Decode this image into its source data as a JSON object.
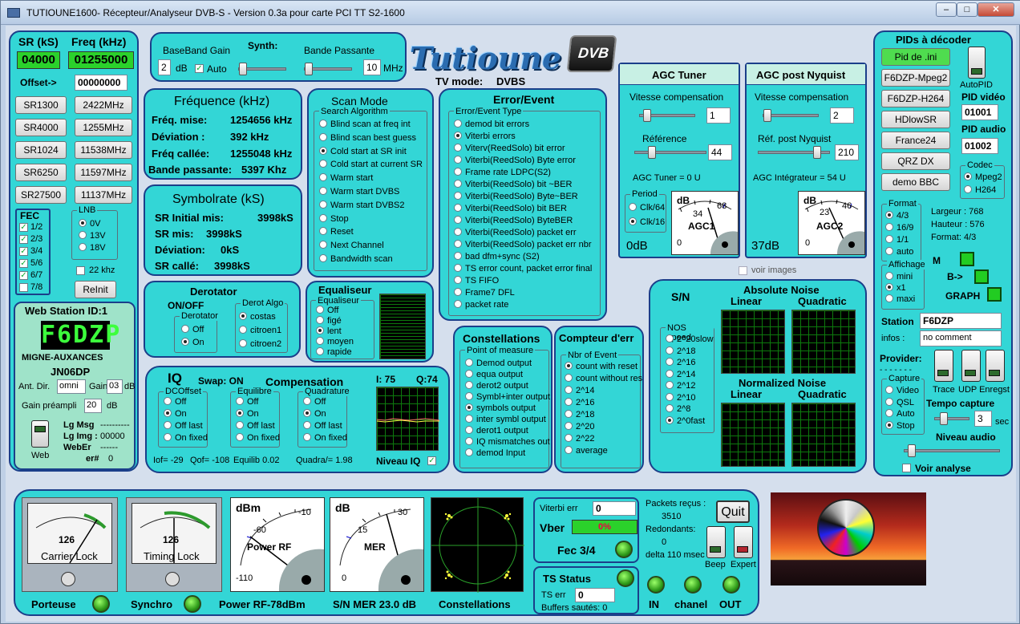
{
  "window": {
    "title": "TUTIOUNE1600- Récepteur/Analyseur DVB-S - Version 0.3a pour carte PCI TT S2-1600",
    "min": "–",
    "max": "□",
    "close": "✕"
  },
  "logo": {
    "text": "Tutioune",
    "dvb": "DVB",
    "tv_mode_label": "TV mode:",
    "tv_mode": "DVBS"
  },
  "srfreq": {
    "sr_label": "SR (kS)",
    "freq_label": "Freq (kHz)",
    "sr_value": "04000",
    "freq_value": "01255000",
    "offset_label": "Offset->",
    "offset_value": "00000000",
    "sr_buttons": [
      "SR1300",
      "SR4000",
      "SR1024",
      "SR6250",
      "SR27500"
    ],
    "freq_buttons": [
      "2422MHz",
      "1255MHz",
      "11538MHz",
      "11597MHz",
      "11137MHz"
    ]
  },
  "fec": {
    "title": "FEC",
    "items": [
      "1/2",
      "2/3",
      "3/4",
      "5/6",
      "6/7",
      "7/8"
    ],
    "checked": [
      true,
      true,
      true,
      true,
      true,
      false
    ]
  },
  "lnb": {
    "title": "LNB",
    "items": [
      "0V",
      "13V",
      "18V"
    ],
    "khz": "22 khz",
    "reinit": "ReInit"
  },
  "web": {
    "title": "Web Station ID:1",
    "callsign": "F6DZP",
    "city": "MIGNE-AUXANCES",
    "locator": "JN06DP",
    "ant_label": "Ant. Dir.",
    "ant_value": "omni",
    "gain_label": "Gain",
    "gain_value": "03",
    "gain_unit": "dB",
    "preampli_label": "Gain préampli",
    "preampli_value": "20",
    "preampli_unit": "dB",
    "web_label": "Web",
    "lgmsg_label": "Lg Msg",
    "lgmsg": "----------",
    "lgimg_label": "Lg Img :",
    "lgimg": "00000",
    "weber_label": "WebEr",
    "weber": "------",
    "err_label": "er#",
    "err": "0"
  },
  "baseband": {
    "gain_label": "BaseBand Gain",
    "synth_label": "Synth:",
    "bande_label": "Bande Passante",
    "gain_value": "2",
    "db": "dB",
    "auto": "Auto",
    "bw_value": "10",
    "mhz": "MHz"
  },
  "frequence": {
    "title": "Fréquence (kHz)",
    "rows": [
      [
        "Fréq. mise:",
        "1254656 kHz"
      ],
      [
        "Déviation :",
        "392 kHz"
      ],
      [
        "Fréq callée:",
        "1255048 kHz"
      ],
      [
        "Bande passante:",
        "5397 Khz"
      ]
    ]
  },
  "symbolrate": {
    "title": "Symbolrate (kS)",
    "rows": [
      [
        "SR Initial mis:",
        "3998kS"
      ],
      [
        "SR mis:",
        "3998kS"
      ],
      [
        "Déviation:",
        "0kS"
      ],
      [
        "SR callé:",
        "3998kS"
      ]
    ]
  },
  "scan": {
    "title": "Scan Mode",
    "group": "Search Algorithm",
    "items": [
      "Blind scan at freq int",
      "Blind scan best guess",
      "Cold start at SR init",
      "Cold start at current SR",
      "Warm start",
      "Warm start DVBS",
      "Warm start DVBS2",
      "Stop",
      "Reset",
      "Next Channel",
      "Bandwidth scan"
    ],
    "selected": 2
  },
  "errorevent": {
    "title": "Error/Event",
    "group": "Error/Event Type",
    "items": [
      "demod bit errors",
      "Viterbi errors",
      "Viterv(ReedSolo) bit error",
      "Viterbi(ReedSolo) Byte error",
      "Frame rate LDPC(S2)",
      "Viterbi(ReedSolo) bit ~BER",
      "Viterbi(ReedSolo) Byte~BER",
      "Viterbi(ReedSolo) bit BER",
      "Viterbi(ReedSolo) ByteBER",
      "Viterbi(ReedSolo) packet err",
      "Viterbi(ReedSolo) packet err nbr",
      "bad dfm+sync (S2)",
      "TS error count, packet error final",
      "TS FIFO",
      "Frame7 DFL",
      "packet rate"
    ],
    "selected": 1
  },
  "agctuner": {
    "title": "AGC Tuner",
    "vitesse_label": "Vitesse compensation",
    "vitesse_value": "1",
    "ref_label": "Référence",
    "ref_value": "44",
    "agc_text": "AGC Tuner = 0 U",
    "period_label": "Period",
    "p1": "Clk/64",
    "p2": "Clk/16",
    "db_value": "0dB",
    "meter_db": "dB",
    "meter_a": "34",
    "meter_b": "68",
    "meter_name": "AGC1",
    "meter_zero": "0"
  },
  "agcnyq": {
    "title": "AGC post Nyquist",
    "vitesse_label": "Vitesse compensation",
    "vitesse_value": "2",
    "ref_label": "Réf. post Nyquist",
    "ref_value": "210",
    "agc_text": "AGC Intégrateur = 54 U",
    "db_value": "37dB",
    "meter_db": "dB",
    "meter_a": "23",
    "meter_b": "46",
    "meter_name": "AGC2",
    "meter_zero": "0",
    "voir": "voir images"
  },
  "derotator": {
    "title": "Derotator",
    "onoff": "ON/OFF",
    "group": "Derotator",
    "items": [
      "Off",
      "On"
    ],
    "selected": 1,
    "algo_group": "Derot Algo",
    "algo_items": [
      "costas",
      "citroen1",
      "citroen2"
    ],
    "algo_selected": 0
  },
  "equal": {
    "title": "Equaliseur",
    "group": "Equaliseur",
    "items": [
      "Off",
      "figé",
      "lent",
      "moyen",
      "rapide"
    ],
    "selected": 2
  },
  "iq": {
    "title": "IQ",
    "swap": "Swap:  ON",
    "comp": "Compensation",
    "i": "I: 75",
    "q": "Q:74",
    "dc_group": "DCOffset",
    "eq_group": "Equilibre",
    "qd_group": "Quadrature",
    "opts": [
      "Off",
      "On",
      "Off last",
      "On fixed"
    ],
    "iof": "Iof= -29",
    "qof": "Qof= -108",
    "equilib": "Equilib  0.02",
    "quadra": "Quadra/= 1.98",
    "niveau": "Niveau IQ"
  },
  "constel": {
    "title": "Constellations",
    "group": "Point of measure",
    "items": [
      "Demod output",
      "equa output",
      "derot2 output",
      "Symbl+inter output",
      "symbols output",
      "inter symbl output",
      "derot1 output",
      "IQ mismatches out",
      "demod Input"
    ],
    "selected": 4
  },
  "compteur": {
    "title": "Compteur d'err",
    "group": "Nbr of Event",
    "items": [
      "count with reset",
      "count without res",
      "2^14",
      "2^16",
      "2^18",
      "2^20",
      "2^22",
      "average"
    ],
    "selected": 0
  },
  "sn": {
    "title": "S/N",
    "abs": "Absolute Noise",
    "norm": "Normalized Noise",
    "lin": "Linear",
    "quad": "Quadratic",
    "nos_group": "NOS speed",
    "nos_items": [
      "2^20slow",
      "2^18",
      "2^16",
      "2^14",
      "2^12",
      "2^10",
      "2^8",
      "2^0fast"
    ],
    "nos_selected": 7
  },
  "pids": {
    "title": "PIDs à décoder",
    "buttons": [
      "Pid de .ini",
      "F6DZP-Mpeg2",
      "F6DZP-H264",
      "HDlowSR",
      "France24",
      "QRZ DX",
      "demo BBC"
    ],
    "autopid": "AutoPID",
    "pid_video_label": "PID vidéo",
    "pid_video": "01001",
    "pid_audio_label": "PID audio",
    "pid_audio": "01002",
    "codec_group": "Codec",
    "codec_items": [
      "Mpeg2",
      "H264"
    ],
    "format_group": "Format",
    "format_items": [
      "4/3",
      "16/9",
      "1/1",
      "auto"
    ],
    "largeur": "Largeur :  768",
    "hauteur": "Hauteur :  576",
    "format": "Format:    4/3",
    "affichage_group": "Affichage",
    "aff_items": [
      "mini",
      "x1",
      "maxi"
    ],
    "m": "M",
    "b": "B->",
    "graph": "GRAPH",
    "station_label": "Station",
    "station": "F6DZP",
    "infos_label": "infos :",
    "infos": "no comment",
    "provider": "Provider:",
    "provider_val": "- - - - - - -",
    "capture_group": "Capture",
    "cap_items": [
      "Video",
      "QSL",
      "Auto",
      "Stop"
    ],
    "trace": "Trace",
    "udp": "UDP Enregst",
    "tempo": "Tempo capture",
    "tempo_val": "3",
    "sec": "sec",
    "niveau": "Niveau audio",
    "voir": "Voir analyse"
  },
  "bottom": {
    "carrier": "Carrier Lock",
    "carrier_val": "126",
    "timing": "Timing Lock",
    "timing_val": "126",
    "porteuse": "Porteuse",
    "synchro": "Synchro",
    "power_label": "Power RF-78dBm",
    "power_meter": "Power RF",
    "power_unit": "dBm",
    "power_a": "-60",
    "power_b": "-10",
    "power_c": "-110",
    "mer_meter": "MER",
    "mer_unit": "dB",
    "mer_a": "15",
    "mer_b": "30",
    "mer_c": "0",
    "sn_mer": "S/N MER  23.0 dB",
    "constellations": "Constellations",
    "viterbi_label": "Viterbi err",
    "viterbi_val": "0",
    "vber": "Vber",
    "vber_val": "0%",
    "fec": "Fec  3/4",
    "ts_status": "TS Status",
    "ts_err_label": "TS err",
    "ts_err": "0",
    "buffers": "Buffers sautés:   0",
    "packets_label": "Packets reçus :",
    "packets": "3510",
    "redondants_label": "Redondants:",
    "redondants": "0",
    "delta": "delta 110 msec",
    "quit": "Quit",
    "beep": "Beep",
    "expert": "Expert",
    "in": "IN",
    "chanel": "chanel",
    "out": "OUT"
  }
}
